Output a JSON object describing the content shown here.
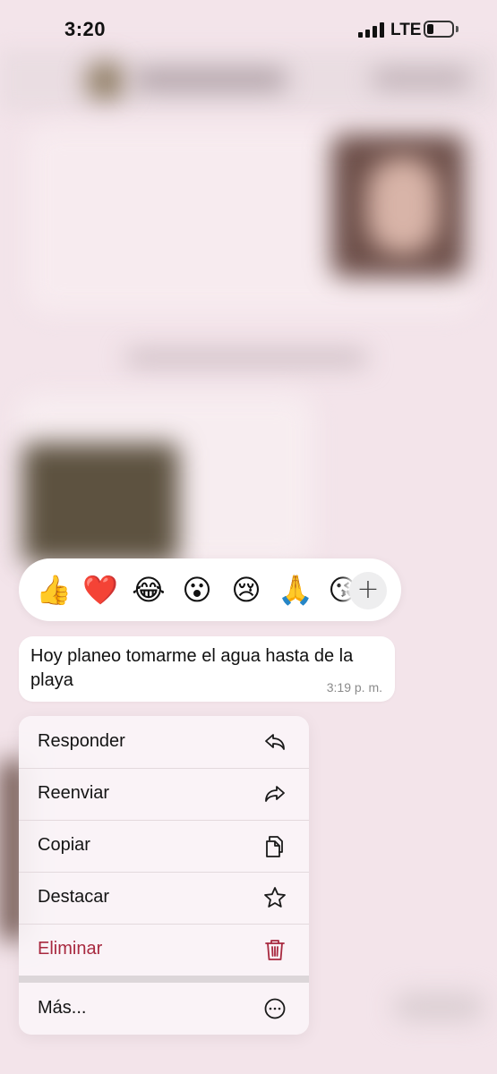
{
  "status_bar": {
    "time": "3:20",
    "network": "LTE",
    "battery_level": 0.25
  },
  "reactions": {
    "items": [
      {
        "emoji": "👍",
        "name": "thumbs-up"
      },
      {
        "emoji": "❤️",
        "name": "red-heart"
      },
      {
        "emoji": "😂",
        "name": "tears-of-joy"
      },
      {
        "emoji": "😮",
        "name": "surprised"
      },
      {
        "emoji": "😢",
        "name": "crying"
      },
      {
        "emoji": "🙏",
        "name": "folded-hands"
      },
      {
        "emoji": "😘",
        "name": "kiss"
      }
    ],
    "more": "+"
  },
  "message": {
    "text": "Hoy planeo tomarme el agua hasta de la playa",
    "time": "3:19 p. m."
  },
  "menu": {
    "items": [
      {
        "label": "Responder",
        "icon": "reply-icon"
      },
      {
        "label": "Reenviar",
        "icon": "forward-icon"
      },
      {
        "label": "Copiar",
        "icon": "copy-icon"
      },
      {
        "label": "Destacar",
        "icon": "star-icon"
      },
      {
        "label": "Eliminar",
        "icon": "trash-icon"
      }
    ],
    "more": {
      "label": "Más...",
      "icon": "more-icon"
    }
  },
  "colors": {
    "background": "#f3e4ea",
    "danger": "#a8293f",
    "time_text": "#8b8b8b"
  }
}
